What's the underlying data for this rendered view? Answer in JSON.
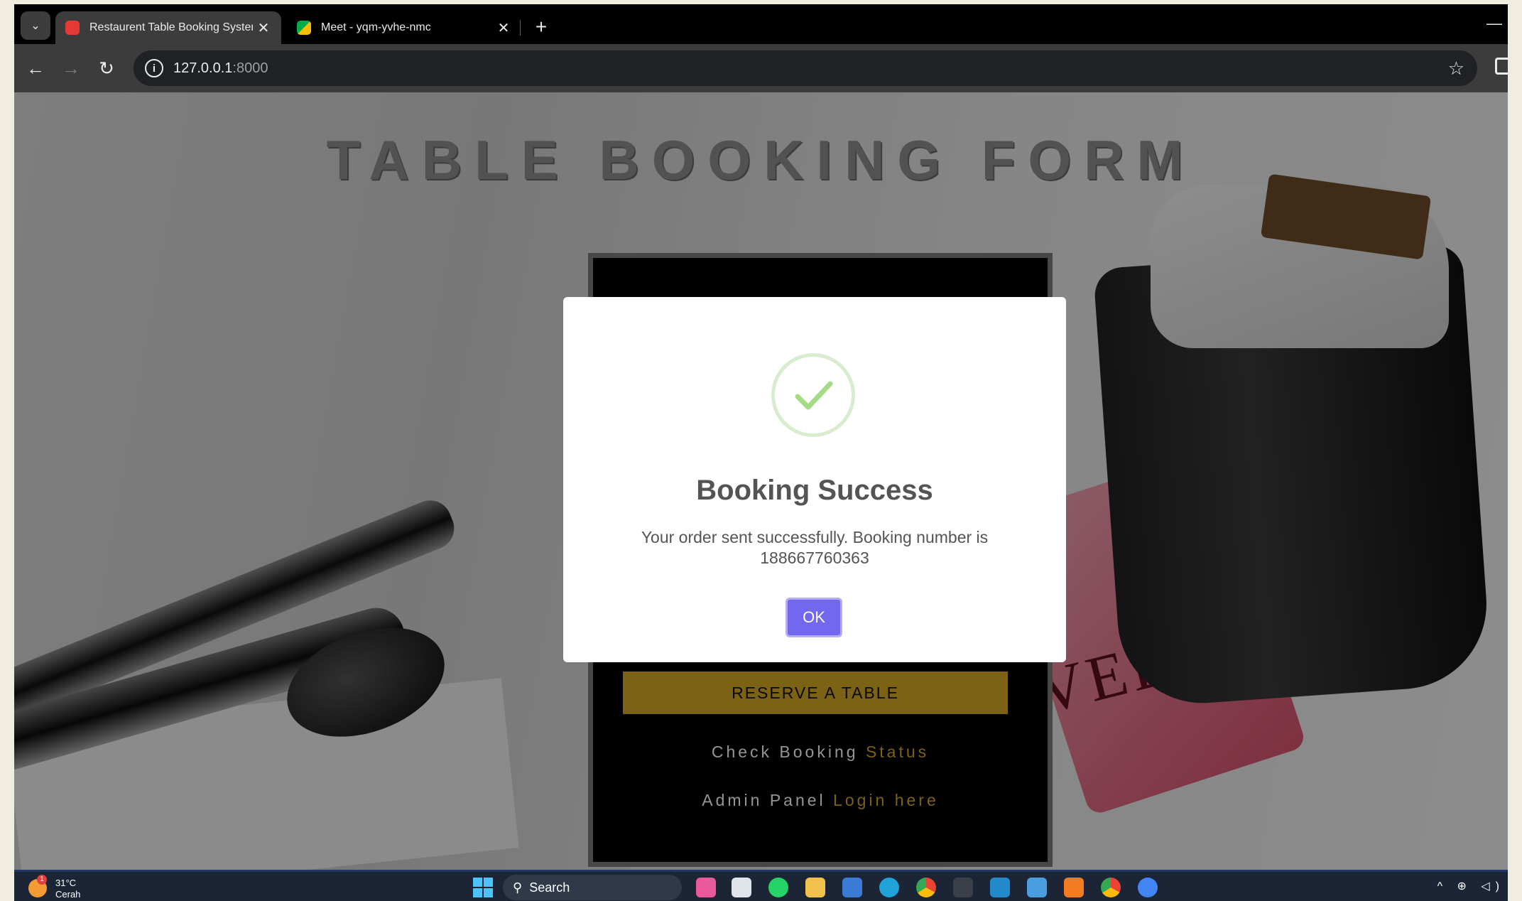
{
  "browser": {
    "tabs": [
      {
        "title": "Restaurent Table Booking System",
        "active": true,
        "favicon": "restaurant-favicon",
        "color": "#e53935"
      },
      {
        "title": "Meet - yqm-yvhe-nmc",
        "active": false,
        "favicon": "google-meet-favicon",
        "color": "#00ac47"
      }
    ],
    "new_tab_label": "+",
    "close_label": "✕",
    "url_host": "127.0.0.1",
    "url_port": ":8000"
  },
  "page": {
    "title": "TABLE BOOKING FORM",
    "reserve_button": "RESERVE A TABLE",
    "check_status": {
      "prefix": "Check Booking ",
      "link": "Status"
    },
    "admin": {
      "prefix": "Admin Panel ",
      "link": "Login here"
    },
    "background_card_text": "VED",
    "accent_color": "#d4a923"
  },
  "modal": {
    "icon": "success-check-icon",
    "title": "Booking Success",
    "message": "Your order sent successfully. Booking number is 188667760363",
    "ok_label": "OK",
    "button_color": "#7367f0"
  },
  "taskbar": {
    "weather_temp": "31°C",
    "weather_desc": "Cerah",
    "weather_badge": "1",
    "search_label": "Search"
  }
}
